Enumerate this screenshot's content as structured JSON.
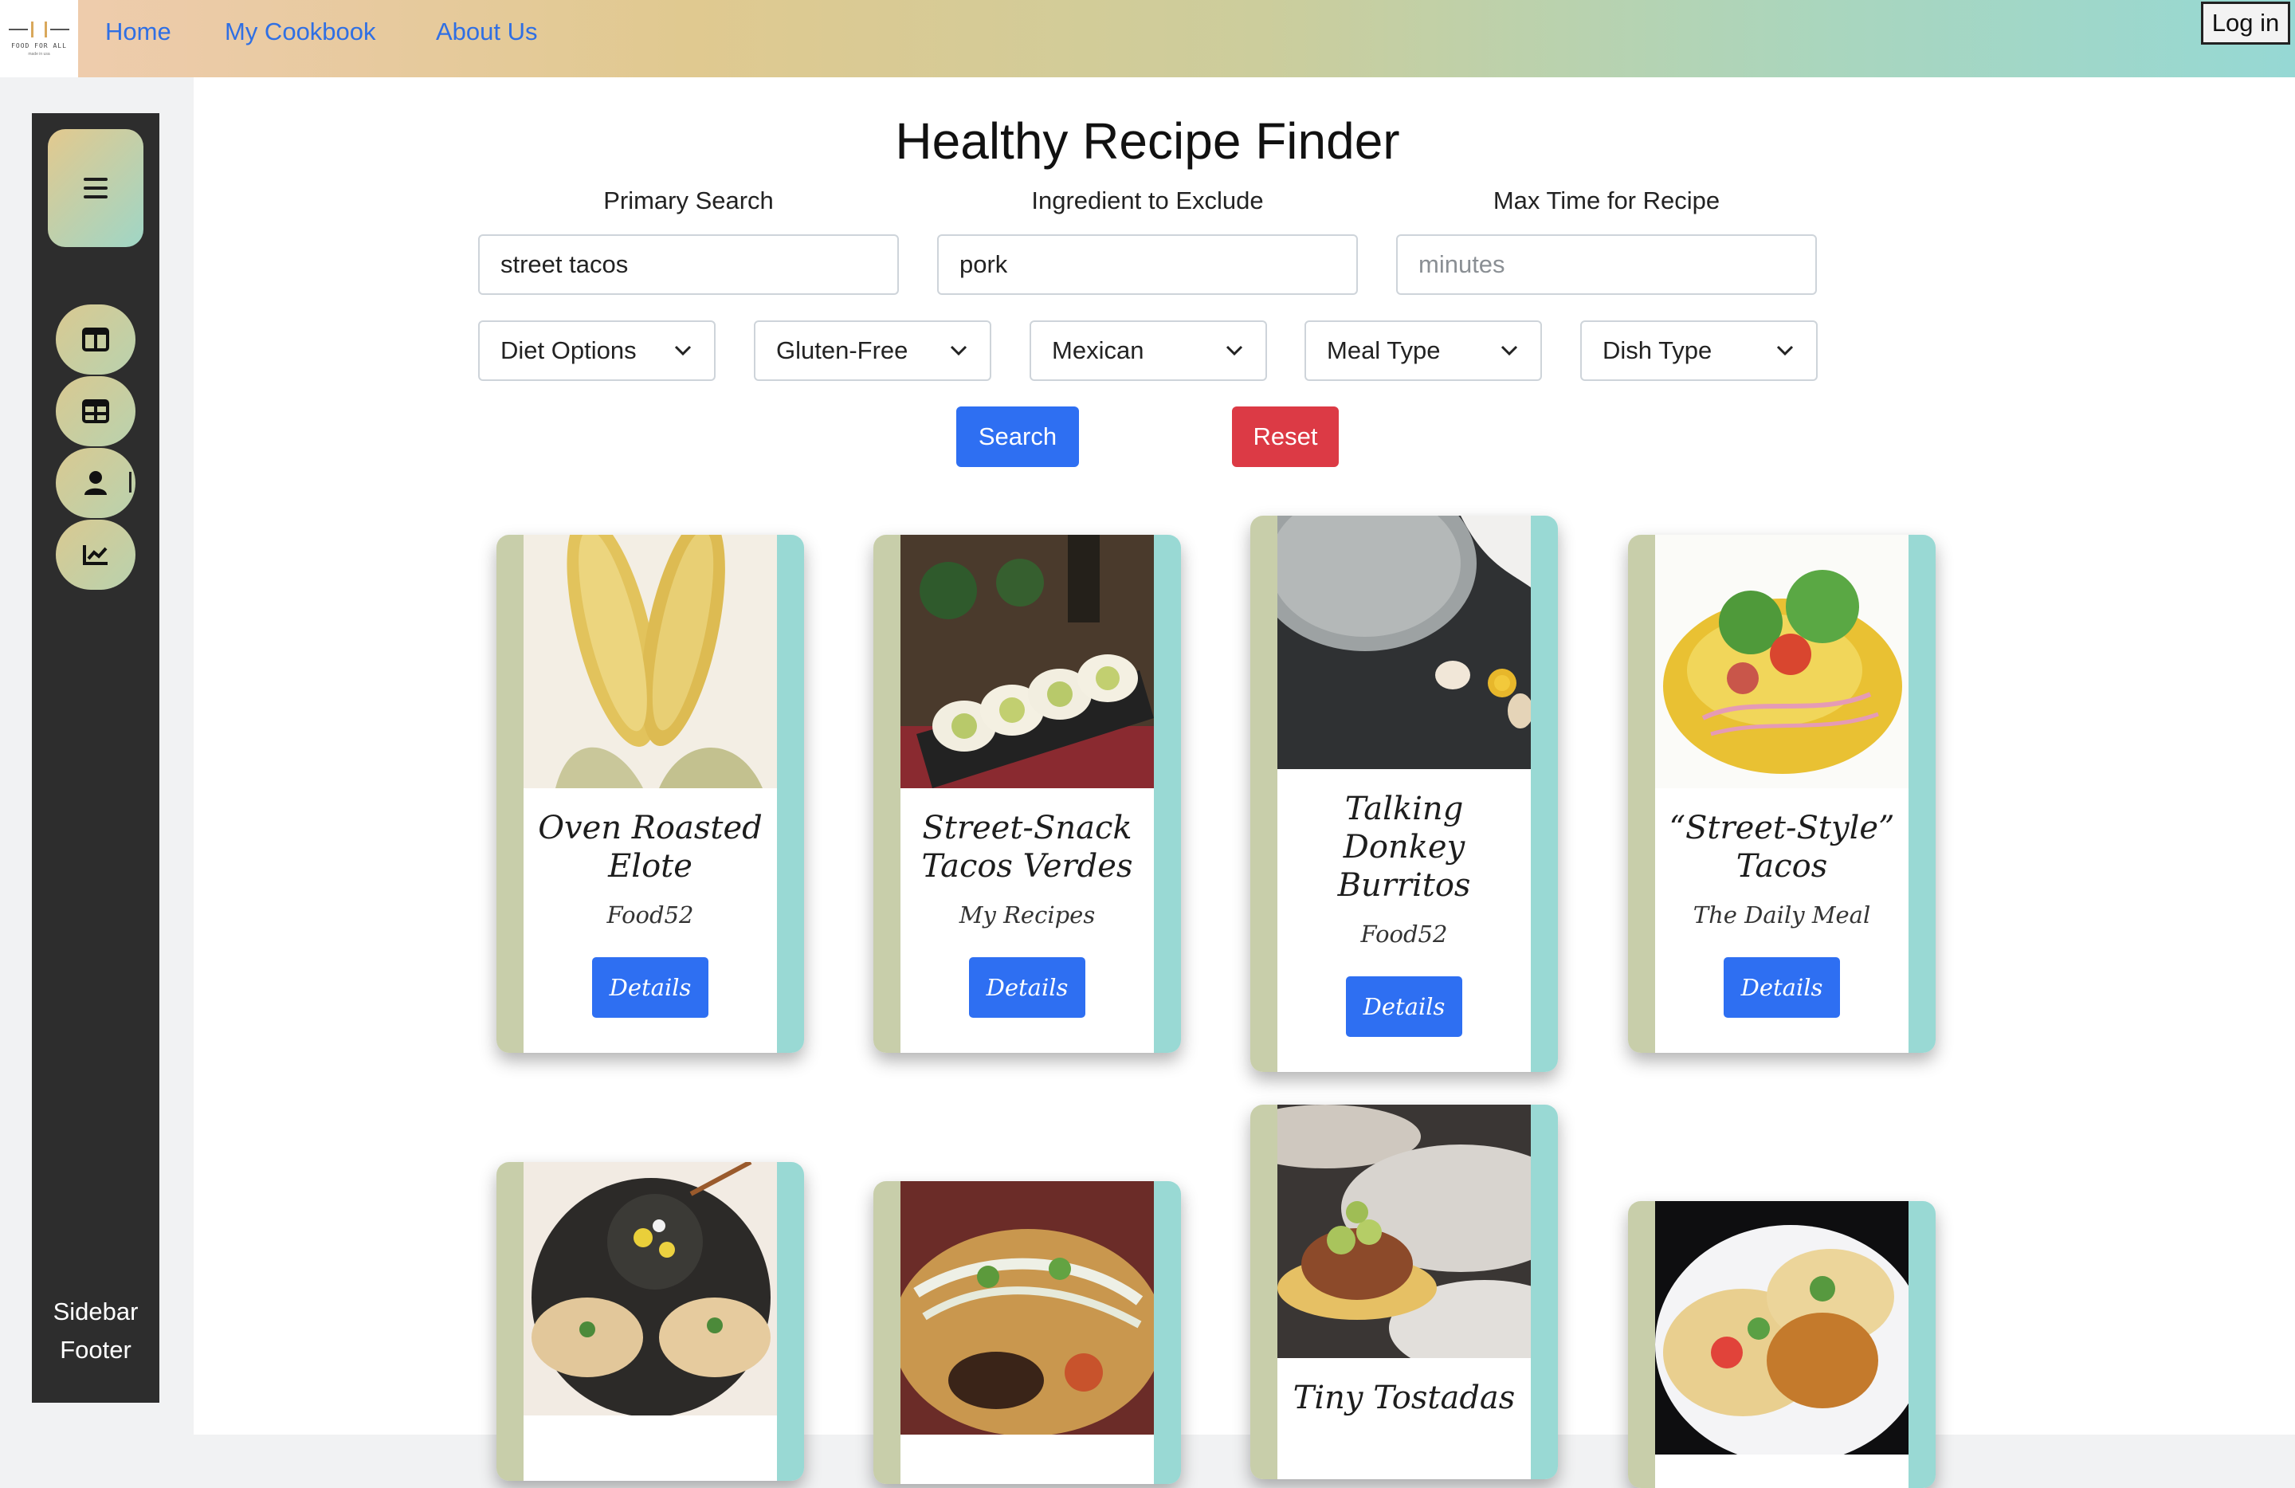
{
  "nav": {
    "logo_text": "FOOD FOR ALL",
    "logo_tagline": "made in usa",
    "links": [
      "Home",
      "My Cookbook",
      "About Us"
    ],
    "login_label": "Log in"
  },
  "sidebar": {
    "icons": [
      "menu-icon",
      "columns-icon",
      "table-icon",
      "user-icon",
      "chart-icon"
    ],
    "footer_line1": "Sidebar",
    "footer_line2": "Footer"
  },
  "finder": {
    "title": "Healthy Recipe Finder",
    "primary_label": "Primary Search",
    "primary_value": "street tacos",
    "exclude_label": "Ingredient to Exclude",
    "exclude_value": "pork",
    "time_label": "Max Time for Recipe",
    "time_placeholder": "minutes",
    "selects": [
      "Diet Options",
      "Gluten-Free",
      "Mexican",
      "Meal Type",
      "Dish Type"
    ],
    "search_label": "Search",
    "reset_label": "Reset"
  },
  "recipes": [
    {
      "title": "Oven Roasted Elote",
      "source": "Food52",
      "button": "Details"
    },
    {
      "title": "Street-Snack Tacos Verdes",
      "source": "My Recipes",
      "button": "Details"
    },
    {
      "title": "Talking Donkey Burritos",
      "source": "Food52",
      "button": "Details"
    },
    {
      "title": "“Street-Style” Tacos",
      "source": "The Daily Meal",
      "button": "Details"
    },
    {
      "title": "",
      "source": "",
      "button": ""
    },
    {
      "title": "",
      "source": "",
      "button": ""
    },
    {
      "title": "Tiny Tostadas",
      "source": "",
      "button": ""
    },
    {
      "title": "",
      "source": "",
      "button": ""
    }
  ],
  "colors": {
    "primary": "#2e6ff2",
    "danger": "#dc3a45",
    "sidebar": "#2d2d2d",
    "link": "#2f6fe4"
  }
}
